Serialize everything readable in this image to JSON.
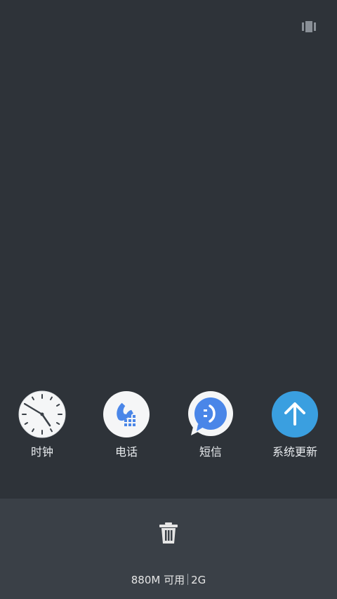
{
  "apps": [
    {
      "label": "时钟",
      "icon": "clock-icon"
    },
    {
      "label": "电话",
      "icon": "phone-icon"
    },
    {
      "label": "短信",
      "icon": "sms-icon"
    },
    {
      "label": "系统更新",
      "icon": "system-update-icon"
    }
  ],
  "memory": {
    "available": "880M 可用",
    "total": "2G"
  },
  "colors": {
    "background": "#2e3339",
    "panel": "#3a4047",
    "accent_blue": "#3a9fe0",
    "phone_blue": "#4a86e8"
  },
  "icons": {
    "top_right": "layout-toggle-icon",
    "clear": "trash-icon"
  }
}
